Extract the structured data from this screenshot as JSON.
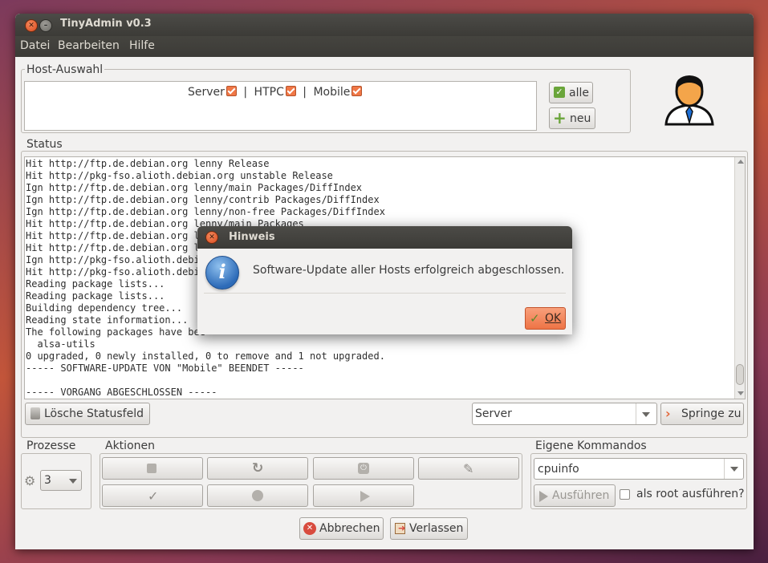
{
  "window": {
    "title": "TinyAdmin v0.3"
  },
  "menu": [
    "Datei",
    "Bearbeiten",
    "Hilfe"
  ],
  "hosts": {
    "label": "Host-Auswahl",
    "items": [
      {
        "name": "Server",
        "checked": true
      },
      {
        "name": "HTPC",
        "checked": true
      },
      {
        "name": "Mobile",
        "checked": true
      }
    ],
    "separator": "|",
    "all_button": "alle",
    "new_button": "neu"
  },
  "status": {
    "label": "Status",
    "lines": [
      "Hit http://ftp.de.debian.org lenny Release",
      "Hit http://pkg-fso.alioth.debian.org unstable Release",
      "Ign http://ftp.de.debian.org lenny/main Packages/DiffIndex",
      "Ign http://ftp.de.debian.org lenny/contrib Packages/DiffIndex",
      "Ign http://ftp.de.debian.org lenny/non-free Packages/DiffIndex",
      "Hit http://ftp.de.debian.org lenny/main Packages",
      "Hit http://ftp.de.debian.org le",
      "Hit http://ftp.de.debian.org le",
      "Ign http://pkg-fso.alioth.debia",
      "Hit http://pkg-fso.alioth.debia",
      "Reading package lists...",
      "Reading package lists...",
      "Building dependency tree...",
      "Reading state information...",
      "The following packages have bee",
      "  alsa-utils",
      "0 upgraded, 0 newly installed, 0 to remove and 1 not upgraded.",
      "----- SOFTWARE-UPDATE VON \"Mobile\" BEENDET -----",
      "",
      "----- VORGANG ABGESCHLOSSEN -----"
    ],
    "clear_button": "Lösche Statusfeld",
    "jump_select": "Server",
    "jump_button": "Springe zu"
  },
  "processes": {
    "label": "Prozesse",
    "value": "3"
  },
  "actions": {
    "label": "Aktionen"
  },
  "commands": {
    "label": "Eigene Kommandos",
    "value": "cpuinfo",
    "run_button": "Ausführen",
    "root_label": "als root ausführen?",
    "root_checked": false
  },
  "bottom": {
    "cancel": "Abbrechen",
    "quit": "Verlassen"
  },
  "dialog": {
    "title": "Hinweis",
    "message": "Software-Update aller Hosts erfolgreich abgeschlossen.",
    "ok": "OK"
  },
  "colors": {
    "accent": "#f07746",
    "titlebar": "#3c3b37",
    "window_bg": "#f2f1f0"
  }
}
